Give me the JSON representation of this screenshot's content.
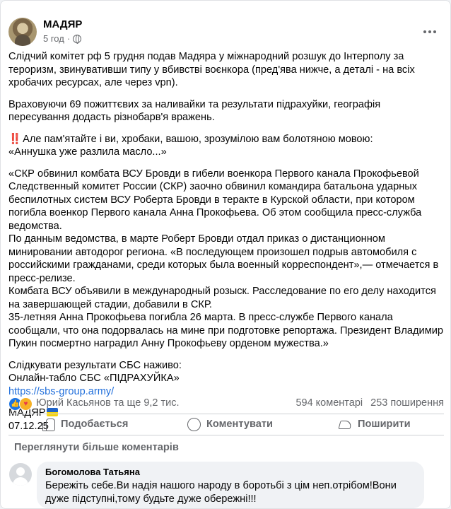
{
  "post": {
    "author": "МАДЯР",
    "time": "5 год",
    "paragraphs": [
      "Слідчий комітет рф 5 грудня подав Мадяра у міжнародний розшук до Інтерполу за тероризм, звинувативши  типу у вбивстві воєнкора  (пред'ява нижче, а деталі - на всіх хробачих ресурсах, але через vpn).",
      "Враховуючи 69 пожиттєвих за наливайки та результати підрахуйки, географія пересування додасть різнобарв'я вражень.",
      "«СКР обвинил комбата ВСУ Бровди в гибели военкора Первого канала Прокофьевой\nСледственный комитет России (СКР) заочно обвинил командира батальона ударных беспилотных систем ВСУ Роберта Бровди в теракте в Курской области, при котором погибла военкор Первого канала Анна Прокофьева. Об этом сообщила пресс-служба ведомства.\nПо данным ведомства, в марте Роберт Бровди отдал приказ о дистанционном минировании автодорог региона. «В последующем произошел подрыв автомобиля с российскими гражданами, среди которых была военный корреспондент»,— отмечается в пресс-релизе.\nКомбата ВСУ объявили в международный розыск. Расследование по его делу находится на завершающей стадии, добавили в СКР.\n35-летняя Анна Прокофьева погибла 26 марта. В пресс-службе Первого канала сообщали, что она подорвалась на мине при подготовке репортажа. Президент Владимир Пукин посмертно наградил Анну Прокофьеву орденом мужества.»"
    ],
    "warning_mark": "‼️",
    "warning_text": "Але пам'ятайте і ви, хробаки, вашою, зрозумілою вам болотяною мовою:\n«Аннушка уже разлила масло...»",
    "follow_text": "Слідкувати результати СБС наживо:\nОнлайн-табло СБС «ПІДРАХУЙКА»",
    "link": "https://sbs-group.army/",
    "signature": "МАДЯР",
    "date": "07.12.25"
  },
  "reactions": {
    "names": "Юрий Касьянов та ще 9,2 тис.",
    "comments": "594 коментарі",
    "shares": "253 поширення"
  },
  "actions": {
    "like": "Подобається",
    "comment": "Коментувати",
    "share": "Поширити"
  },
  "comments_section": {
    "view_more": "Переглянути більше коментарів",
    "items": [
      {
        "author": "Богомолова Татьяна",
        "text": "Бережіть себе.Ви надія нашого народу в боротьбі з цім неп.отрібом!Вони дуже підступні,тому будьте дуже обережні!!!"
      }
    ]
  },
  "colors": {
    "link": "#216fdb",
    "like_blue": "#1b74e4",
    "muted": "#65676b"
  }
}
